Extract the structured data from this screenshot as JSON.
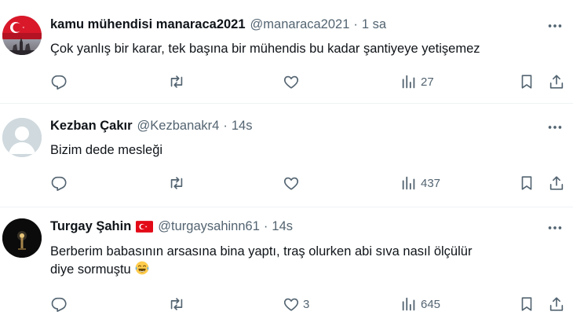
{
  "tweets": [
    {
      "display_name": "kamu mühendisi manaraca2021",
      "handle": "@manaraca2021",
      "separator": "·",
      "time": "1 sa",
      "text": "Çok yanlış bir karar, tek başına bir mühendis bu kadar şantiyeye yetişemez",
      "replies": "",
      "retweets": "",
      "likes": "",
      "views": "27",
      "avatar": "turkish-flag-profile-picture"
    },
    {
      "display_name": "Kezban Çakır",
      "handle": "@Kezbanakr4",
      "separator": "·",
      "time": "14s",
      "text": "Bizim dede mesleği",
      "replies": "",
      "retweets": "",
      "likes": "",
      "views": "437",
      "avatar": "default-profile-picture"
    },
    {
      "display_name": "Turgay Şahin",
      "handle": "@turgaysahinn61",
      "separator": "·",
      "time": "14s",
      "text_line1": "Berberim babasının arsasına bina yaptı, traş olurken  abi sıva nasıl ölçülür",
      "text_line2": "diye sormuştu",
      "replies": "",
      "retweets": "",
      "likes": "3",
      "views": "645",
      "avatar": "night-scene-profile-picture",
      "name_badge": "turkish-flag-emoji",
      "text_emoji": "face-with-tears-of-joy-emoji"
    }
  ],
  "colors": {
    "text_primary": "#0f1419",
    "text_secondary": "#536471",
    "divider": "#eff3f4",
    "flag_red": "#e30a17"
  },
  "icons": [
    "reply-icon",
    "retweet-icon",
    "like-icon",
    "views-icon",
    "bookmark-icon",
    "share-icon",
    "more-icon"
  ]
}
